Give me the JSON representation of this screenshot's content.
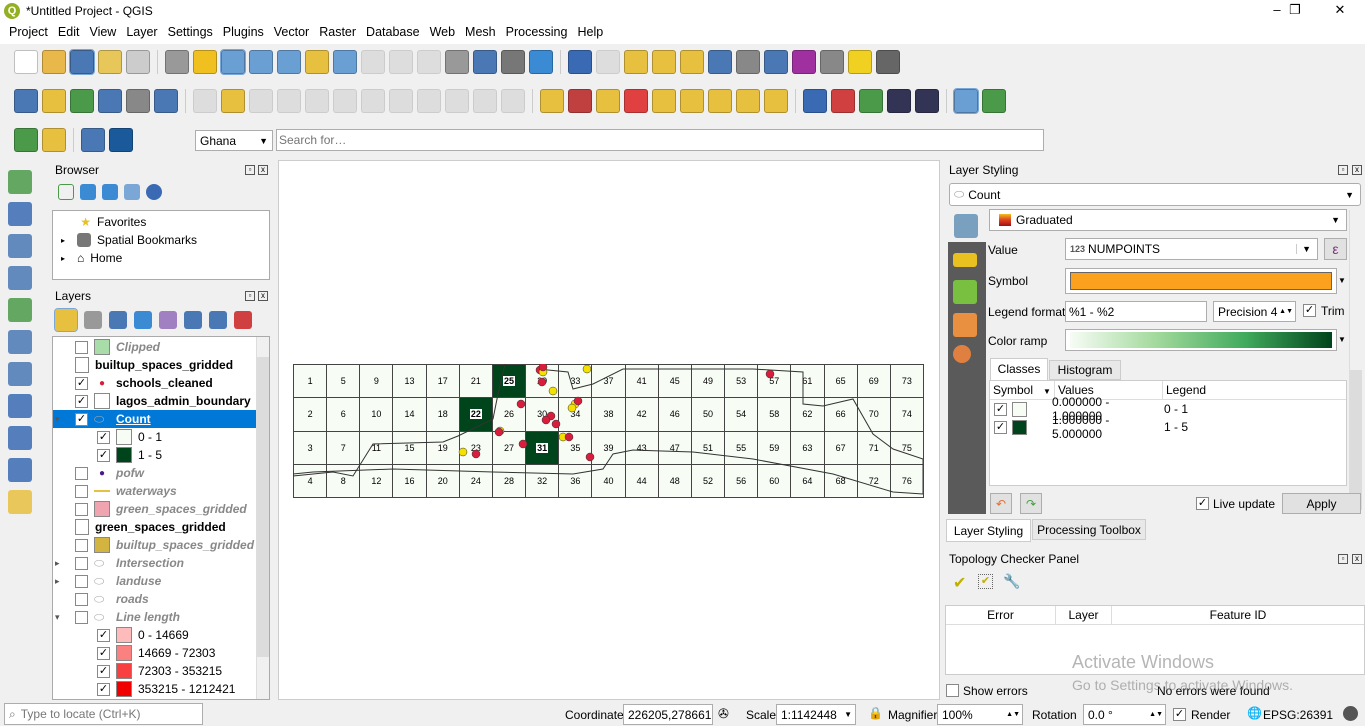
{
  "window": {
    "title": "*Untitled Project - QGIS",
    "controls": [
      "–",
      "❐",
      "✕"
    ]
  },
  "menu": [
    "Project",
    "Edit",
    "View",
    "Layer",
    "Settings",
    "Plugins",
    "Vector",
    "Raster",
    "Database",
    "Web",
    "Mesh",
    "Processing",
    "Help"
  ],
  "toolbar1": [
    [
      "new-project",
      "#fff"
    ],
    [
      "open-project",
      "#e8b84a"
    ],
    [
      "save-project",
      "#4a78b4"
    ],
    [
      "new-print-layout",
      "#e8c75a"
    ],
    [
      "layout-manager",
      "#ccc"
    ],
    [
      "|",
      ""
    ],
    [
      "pan",
      "#999"
    ],
    [
      "pan-to-selection",
      "#f0c020"
    ],
    [
      "zoom-in",
      "#6a9fd4"
    ],
    [
      "zoom-out",
      "#6a9fd4"
    ],
    [
      "zoom-full",
      "#6a9fd4"
    ],
    [
      "zoom-to-selection",
      "#e8c040"
    ],
    [
      "zoom-to-layer",
      "#6a9fd4"
    ],
    [
      "zoom-native",
      "#bbb"
    ],
    [
      "zoom-last",
      "#bbb"
    ],
    [
      "zoom-next",
      "#bbb"
    ],
    [
      "new-map-view",
      "#999"
    ],
    [
      "new-bookmark",
      "#4a78b4"
    ],
    [
      "show-bookmarks",
      "#777"
    ],
    [
      "refresh",
      "#3a8ad4"
    ],
    [
      "|",
      ""
    ],
    [
      "identify",
      "#3a6ab4"
    ],
    [
      "actions",
      "#bbb"
    ],
    [
      "select",
      "#e8c040"
    ],
    [
      "attribute-table",
      "#e8c040"
    ],
    [
      "deselect",
      "#e8c040"
    ],
    [
      "open-table",
      "#4a78b4"
    ],
    [
      "field-calculator",
      "#888"
    ],
    [
      "toolbox",
      "#4a78b4"
    ],
    [
      "statistics",
      "#a030a0"
    ],
    [
      "measure",
      "#888"
    ],
    [
      "annotation",
      "#f0d020"
    ],
    [
      "text-annotation",
      "#666"
    ]
  ],
  "toolbar2": [
    [
      "data-source-manager",
      "#4a78b4"
    ],
    [
      "new-geopackage",
      "#e8c040"
    ],
    [
      "digitize",
      "#4a9a4a"
    ],
    [
      "digitize-curve",
      "#4a78b4"
    ],
    [
      "gps",
      "#888"
    ],
    [
      "temporal",
      "#4a78b4"
    ],
    [
      "|",
      ""
    ],
    [
      "edits",
      "#bbb"
    ],
    [
      "toggle-edit",
      "#e8c040"
    ],
    [
      "save-edits",
      "#bbb"
    ],
    [
      "add-feature",
      "#bbb"
    ],
    [
      "vertex-tool",
      "#bbb"
    ],
    [
      "modify-attributes",
      "#bbb"
    ],
    [
      "delete",
      "#bbb"
    ],
    [
      "cut",
      "#bbb"
    ],
    [
      "copy",
      "#bbb"
    ],
    [
      "paste",
      "#bbb"
    ],
    [
      "undo",
      "#bbb"
    ],
    [
      "redo",
      "#bbb"
    ],
    [
      "|",
      ""
    ],
    [
      "label",
      "#e8c040"
    ],
    [
      "diagram",
      "#c04040"
    ],
    [
      "label-pin",
      "#e8c040"
    ],
    [
      "label-hl",
      "#e04040"
    ],
    [
      "label-move",
      "#e8c040"
    ],
    [
      "label-show",
      "#e8c040"
    ],
    [
      "label-rotate",
      "#e8c040"
    ],
    [
      "label-change",
      "#e8c040"
    ],
    [
      "label-props",
      "#e8c040"
    ],
    [
      "|",
      ""
    ],
    [
      "python",
      "#3a6ab4"
    ],
    [
      "plugin",
      "#d04040"
    ],
    [
      "layers-plugin",
      "#4a9a4a"
    ],
    [
      "globe",
      "#335"
    ],
    [
      "help",
      "#335"
    ],
    [
      "|",
      ""
    ],
    [
      "topology-checker",
      "#6a9fd4"
    ],
    [
      "refresh-plugin",
      "#4a9a4a"
    ]
  ],
  "toolbar3": [
    [
      "locator-search",
      "#4a9a4a"
    ],
    [
      "stat-plugin",
      "#e8c040"
    ],
    [
      "|",
      ""
    ],
    [
      "profile",
      "#4a78b4"
    ],
    [
      "geocode-search",
      "#1a5a9a"
    ]
  ],
  "locator": {
    "country": "Ghana",
    "search_placeholder": "Search for…"
  },
  "left_toolbar": [
    "add-vector-layer",
    "add-raster-layer",
    "add-mesh-layer",
    "add-delimited-text",
    "add-spatialite",
    "add-virtual-layer",
    "add-postgis",
    "add-wms",
    "add-wfs",
    "add-wcs",
    "add-gpkg"
  ],
  "browser": {
    "title": "Browser",
    "items": [
      "Favorites",
      "Spatial Bookmarks",
      "Home"
    ]
  },
  "layers": {
    "title": "Layers",
    "items": [
      {
        "name": "Clipped",
        "style": "it",
        "check": false,
        "sw": "#a8dca8"
      },
      {
        "name": "builtup_spaces_gridded",
        "style": "b",
        "table": true
      },
      {
        "name": "schools_cleaned",
        "style": "b",
        "check": true,
        "dot": "#d81e3c"
      },
      {
        "name": "lagos_admin_boundary",
        "style": "b",
        "check": true,
        "sw": "#fff"
      },
      {
        "name": "Count",
        "style": "sel",
        "check": true,
        "expand": "▾"
      },
      {
        "name": "0 - 1",
        "check": true,
        "sw": "#f7fcf5",
        "sub": true
      },
      {
        "name": "1 - 5",
        "check": true,
        "sw": "#00441b",
        "sub": true
      },
      {
        "name": "pofw",
        "style": "it",
        "check": false,
        "dot": "#4b1a8a"
      },
      {
        "name": "waterways",
        "style": "it",
        "check": false,
        "line": "#e8c040"
      },
      {
        "name": "green_spaces_gridded",
        "style": "it",
        "check": false,
        "sw": "#f0a4b0"
      },
      {
        "name": "green_spaces_gridded",
        "style": "b",
        "table": true
      },
      {
        "name": "builtup_spaces_gridded",
        "style": "it",
        "check": false,
        "sw": "#d4b440"
      },
      {
        "name": "Intersection",
        "style": "it",
        "check": false,
        "expand": "▸"
      },
      {
        "name": "landuse",
        "style": "it",
        "check": false,
        "expand": "▸"
      },
      {
        "name": "roads",
        "style": "it",
        "check": false
      },
      {
        "name": "Line length",
        "style": "it",
        "check": false,
        "expand": "▾"
      },
      {
        "name": "0 - 14669",
        "check": true,
        "sw": "#fdbbbb",
        "sub": true
      },
      {
        "name": "14669 - 72303",
        "check": true,
        "sw": "#fb8080",
        "sub": true
      },
      {
        "name": "72303 - 353215",
        "check": true,
        "sw": "#f84040",
        "sub": true
      },
      {
        "name": "353215 - 1212421",
        "check": true,
        "sw": "#f00000",
        "sub": true
      }
    ]
  },
  "map": {
    "cell_labels": [
      1,
      2,
      3,
      4,
      5,
      6,
      7,
      8,
      9,
      10,
      11,
      12,
      13,
      14,
      15,
      16,
      17,
      18,
      19,
      20,
      21,
      22,
      23,
      24,
      25,
      26,
      27,
      28,
      29,
      30,
      31,
      32,
      33,
      34,
      35,
      36,
      37,
      38,
      39,
      40,
      41,
      42,
      43,
      44,
      45,
      46,
      47,
      48,
      49,
      50,
      51,
      52,
      53,
      54,
      55,
      56,
      57,
      58,
      59,
      60,
      61,
      62,
      63,
      64,
      65,
      66,
      67,
      68,
      69,
      70,
      71,
      72,
      73,
      74,
      75,
      76
    ],
    "dark_cells": [
      22,
      25,
      31
    ],
    "light_color": "#f7fcf5",
    "dark_color": "#00441b"
  },
  "styling": {
    "title": "Layer Styling",
    "layer": "Count",
    "renderer": "Graduated",
    "value_label": "Value",
    "value_prefix": "123",
    "value": "NUMPOINTS",
    "symbol_label": "Symbol",
    "symbol_color": "#fca11e",
    "legend_format_label": "Legend format",
    "legend_format": "%1 - %2",
    "precision": "Precision 4",
    "trim": "Trim",
    "color_ramp_label": "Color ramp",
    "tabs": [
      "Classes",
      "Histogram"
    ],
    "columns": [
      "Symbol",
      "Values",
      "Legend"
    ],
    "classes": [
      {
        "values": "0.000000 - 1.000000",
        "legend": "0 - 1",
        "color": "#f7fcf5"
      },
      {
        "values": "1.000000 - 5.000000",
        "legend": "1 - 5",
        "color": "#00441b"
      }
    ],
    "live_update": "Live update",
    "apply": "Apply",
    "bottom_tabs": [
      "Layer Styling",
      "Processing Toolbox"
    ]
  },
  "topology": {
    "title": "Topology Checker Panel",
    "columns": [
      "Error",
      "Layer",
      "Feature ID"
    ],
    "show_errors": "Show errors",
    "status": "No errors were found"
  },
  "watermark": {
    "line1": "Activate Windows",
    "line2": "Go to Settings to activate Windows."
  },
  "status": {
    "locate_placeholder": "Type to locate (Ctrl+K)",
    "coordinate_label": "Coordinate",
    "coordinate": "226205,278661",
    "scale_label": "Scale",
    "scale": "1:1142448",
    "magnifier_label": "Magnifier",
    "magnifier": "100%",
    "rotation_label": "Rotation",
    "rotation": "0.0 °",
    "render": "Render",
    "crs": "EPSG:26391"
  }
}
